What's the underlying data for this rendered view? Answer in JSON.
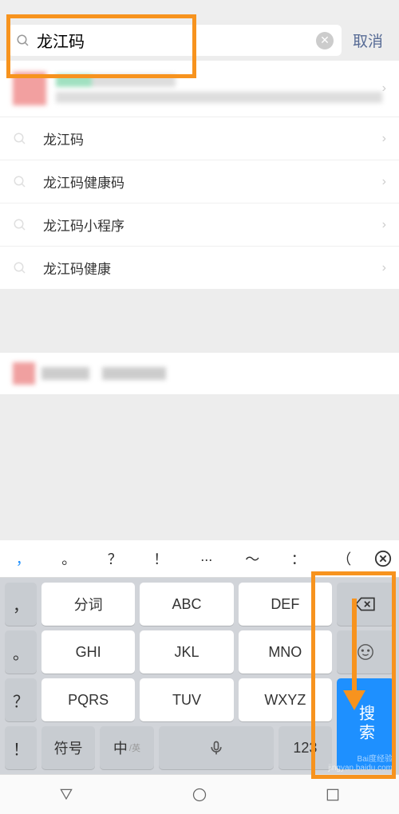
{
  "search": {
    "value": "龙江码",
    "cancel": "取消"
  },
  "suggestions": [
    "龙江码",
    "龙江码健康码",
    "龙江码小程序",
    "龙江码健康"
  ],
  "keyboard": {
    "punctuation": [
      "，",
      "。",
      "？",
      "！",
      "...",
      "～",
      "：",
      "（"
    ],
    "left_col": [
      "，",
      "。",
      "？",
      "！"
    ],
    "main_rows": [
      [
        "分词",
        "ABC",
        "DEF"
      ],
      [
        "GHI",
        "JKL",
        "MNO"
      ],
      [
        "PQRS",
        "TUV",
        "WXYZ"
      ]
    ],
    "bottom_row": {
      "symbol": "符号",
      "lang_main": "中",
      "lang_sub": "/英",
      "number": "123"
    },
    "search": "搜索"
  },
  "watermark": {
    "line1": "Bai度经验",
    "line2": "jingyan.baidu.com"
  }
}
